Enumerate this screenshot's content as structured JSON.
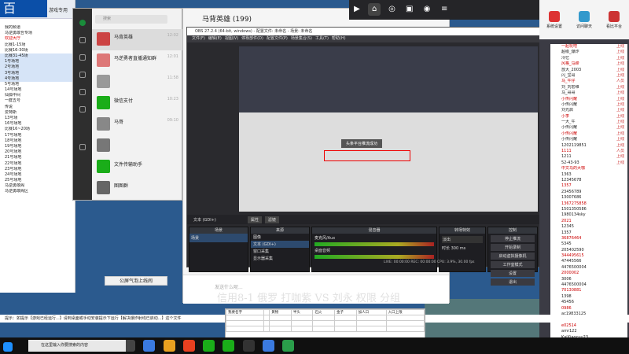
{
  "colors": {
    "obs_bg": "#2a2a2e",
    "accent": "#0b4fa8",
    "red": "#d00000"
  },
  "left_panel": {
    "title": "游戏专用",
    "tree": [
      "我的频道",
      "马逆勇敢吾专场",
      "欢迎大厅",
      "比赛1-15场",
      "比赛16-30场",
      "比赛31-45场",
      "1号场地",
      "2号场地",
      "3号场地",
      "4号场地",
      "5号场地",
      "14号场地",
      "仙狐中间",
      "一群五号",
      "传说",
      "爱特斯",
      "13号场",
      "16号场地",
      "比赛16~20场",
      "17号场地",
      "18号场地",
      "19号场地",
      "20号场地",
      "21号场地",
      "22号场地",
      "23号场地",
      "24号场地",
      "25号场地",
      "马逆勇敢阁",
      "马逆勇敢阁区"
    ]
  },
  "wechat": {
    "search": "搜索",
    "chats": [
      {
        "name": "马背英雄",
        "sub": "",
        "time": "12:02"
      },
      {
        "name": "马逆勇者直播通知群",
        "sub": "",
        "time": "12:01"
      },
      {
        "name": "",
        "sub": "",
        "time": "11:58"
      },
      {
        "name": "微信支付",
        "sub": "",
        "time": "10:23"
      },
      {
        "name": "马哥",
        "sub": "",
        "time": "09:10"
      },
      {
        "name": "",
        "sub": "",
        "time": ""
      },
      {
        "name": "文件传输助手",
        "sub": "",
        "time": ""
      },
      {
        "name": "图图群",
        "sub": "",
        "time": ""
      }
    ]
  },
  "chatwin": {
    "title": "马背英雄 (199)",
    "input_placeholder": "发送什么呢...",
    "btn_follow": "公屏气泡上线闹",
    "send": "发送"
  },
  "obs": {
    "title": "OBS 27.2.4 (64-bit, windows) - 配置文件: 未命名 - 场景: 未命名",
    "menu": [
      "文件(F)",
      "编辑(E)",
      "视图(V)",
      "停靠部件(D)",
      "配置文件(P)",
      "场景集合(S)",
      "工具(T)",
      "帮助(H)"
    ],
    "docks": {
      "scenes": "场景",
      "sources": "来源",
      "mixer": "混音器",
      "transitions": "转场特效",
      "controls": "控制"
    },
    "scene_items": [
      "场景"
    ],
    "source_items": [
      "图像",
      "文本 (GDI+)",
      "窗口采集",
      "显示器采集"
    ],
    "mixer_items": [
      "麦克风/Aux",
      "桌面音频"
    ],
    "transition": {
      "type": "淡出",
      "duration_label": "时长",
      "duration": "300 ms"
    },
    "controls": [
      "停止推流",
      "开始录制",
      "启动虚拟摄像机",
      "工作室模式",
      "设置",
      "退出"
    ],
    "status": "LIVE: 00:00:00  REC: 00:00:00  CPU: 3.9%, 30.00 fps",
    "notice": "头条平台推流成功",
    "source_label": "文本 (GDI+)",
    "props_btn": "属性",
    "filter_btn": "滤镜"
  },
  "caption": "信用8-1 俄罗 打咖紫 VS 刘永 权限 分组",
  "sheet": {
    "headers": [
      "我要名字",
      "",
      "黄物",
      "半头",
      "石火",
      "金子",
      "加人口",
      "入口上限"
    ]
  },
  "note": "提示：如提示【游戏已经运行...】请到桌面或手动安装提示下运行【解决爆炸射线已启动...】这个文件",
  "right_panel": {
    "top_labels": [
      "系统设置",
      "访问聊天",
      "看比平台"
    ],
    "badge": "36",
    "users": [
      "一起玩吧",
      "超级_爆炸",
      "冷忆",
      "风格_马蹄",
      "放大_2003",
      "闪_宝哥",
      "马_牛仔",
      "刘_刘宏维",
      "马_哥哥",
      "小传闪耀",
      "小传闪耀",
      "刘光启",
      "小李",
      "一大_牛",
      "小传闪耀",
      "小传闪耀",
      "小传闪耀",
      "1202119851",
      "1111",
      "1211",
      "52-43-93",
      "中文马的大咖",
      "1363",
      "12345678",
      "1357",
      "23456789",
      "13007686",
      "1367275858",
      "1501350586",
      "1980134sky",
      "2021",
      "12345",
      "1357",
      "36876464",
      "5345",
      "205402590",
      "344495615",
      "47445566",
      "4476500004",
      "2000002",
      "3006",
      "4476500004",
      "70130881",
      "1398",
      "45456",
      "0986",
      "ac19833125",
      "1290300000",
      "e02514",
      "amr122",
      "KaiXiaocuu23",
      "hyenuc23"
    ],
    "badges": [
      "上线",
      "上线",
      "上线",
      "上线",
      "上线",
      "上线",
      "人员",
      "上线",
      "上线",
      "上线",
      "上线",
      "上线",
      "上线",
      "上线",
      "上线",
      "上线",
      "上线",
      "上线",
      "人员",
      "上线",
      "上线"
    ]
  },
  "taskbar": {
    "search": "在这里输入你要搜索的内容"
  }
}
